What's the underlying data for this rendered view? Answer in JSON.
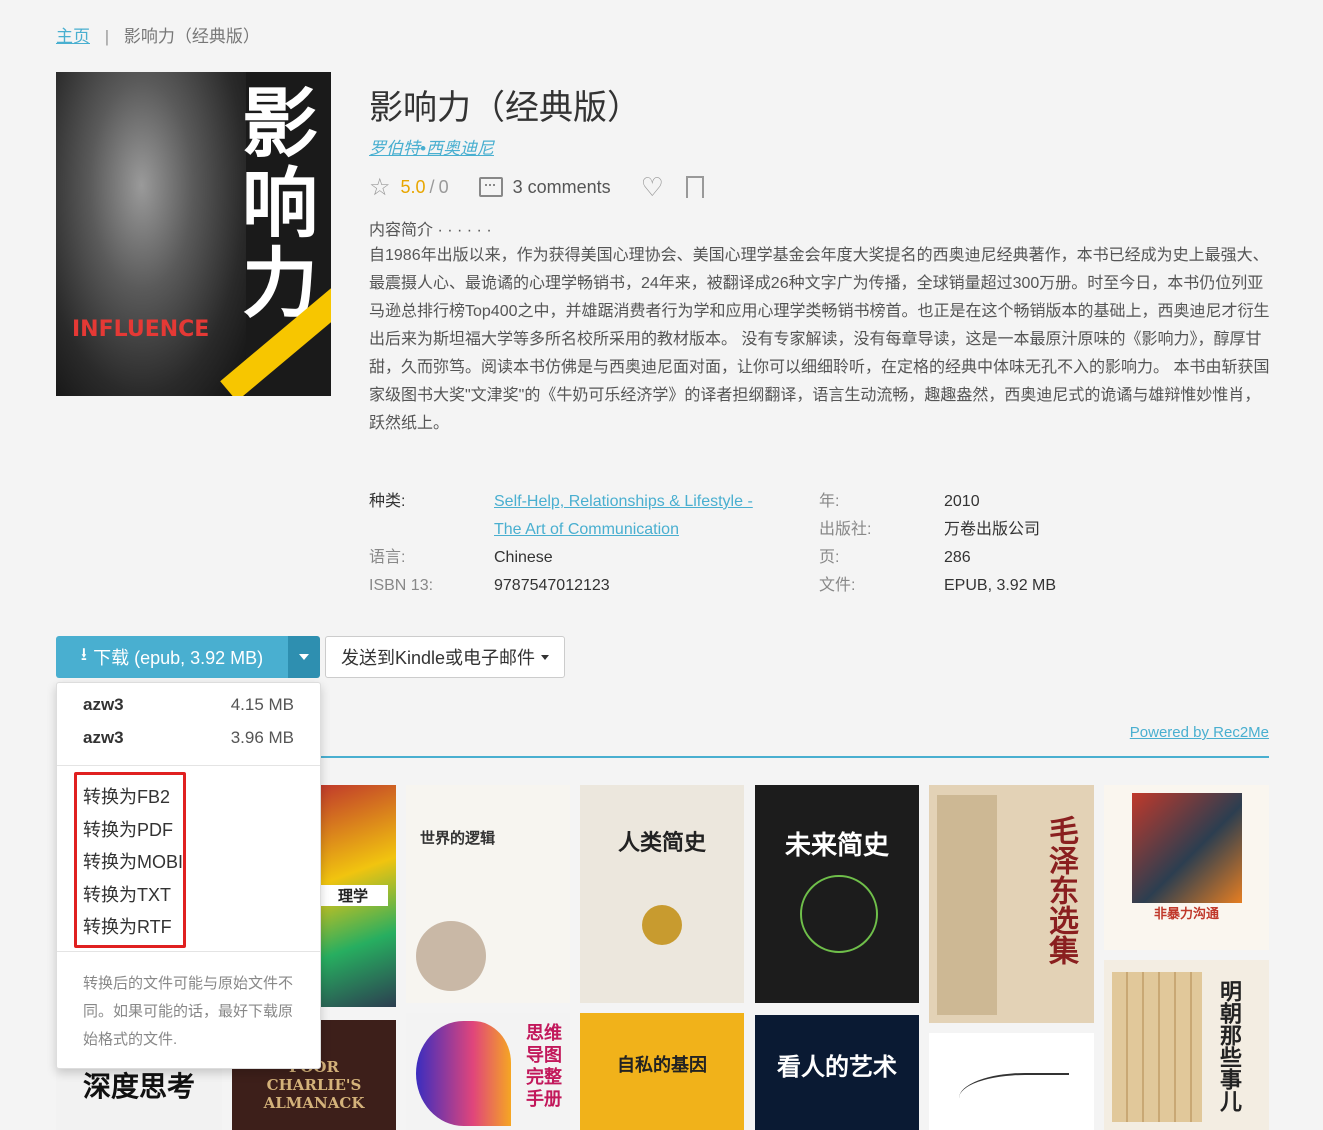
{
  "breadcrumb": {
    "home": "主页",
    "separator": "|",
    "current": "影响力（经典版）"
  },
  "book": {
    "title": "影响力（经典版）",
    "author": "罗伯特•西奥迪尼",
    "rating": "5.0",
    "rating_sep": "/",
    "rating_count": "0",
    "comments": "3 comments",
    "description_label": "内容简介 · · · · · ·",
    "description": "自1986年出版以来，作为获得美国心理协会、美国心理学基金会年度大奖提名的西奥迪尼经典著作，本书已经成为史上最强大、最震摄人心、最诡谲的心理学畅销书，24年来，被翻译成26种文字广为传播，全球销量超过300万册。时至今日，本书仍位列亚马逊总排行榜Top400之中，并雄踞消费者行为学和应用心理学类畅销书榜首。也正是在这个畅销版本的基础上，西奥迪尼才衍生出后来为斯坦福大学等多所名校所采用的教材版本。 没有专家解读，没有每章导读，这是一本最原汁原味的《影响力》，醇厚甘甜，久而弥笃。阅读本书仿佛是与西奥迪尼面对面，让你可以细细聆听，在定格的经典中体味无孔不入的影响力。 本书由斩获国家级图书大奖\"文津奖\"的《牛奶可乐经济学》的译者担纲翻译，语言生动流畅，趣趣盎然，西奥迪尼式的诡谲与雄辩惟妙惟肖，跃然纸上。",
    "cover": {
      "big_text": "影响力",
      "influence": "INFLUENCE"
    }
  },
  "properties": {
    "category_label": "种类:",
    "category_line1": "Self-Help, Relationships & Lifestyle -",
    "category_line2": "The Art of Communication",
    "language_label": "语言:",
    "language": "Chinese",
    "isbn_label": "ISBN 13:",
    "isbn": "9787547012123",
    "year_label": "年:",
    "year": "2010",
    "publisher_label": "出版社:",
    "publisher": "万卷出版公司",
    "pages_label": "页:",
    "pages": "286",
    "file_label": "文件:",
    "file": "EPUB, 3.92 MB"
  },
  "actions": {
    "download_label": "下载 (epub, 3.92 MB)",
    "send_label": "发送到Kindle或电子邮件"
  },
  "dropdown": {
    "files": [
      {
        "format": "azw3",
        "size": "4.15 MB"
      },
      {
        "format": "azw3",
        "size": "3.96 MB"
      }
    ],
    "conversions": [
      "转换为FB2",
      "转换为PDF",
      "转换为MOBI",
      "转换为TXT",
      "转换为RTF"
    ],
    "note": "转换后的文件可能与原始文件不同。如果可能的话，最好下载原始格式的文件."
  },
  "recommendations": {
    "powered_by": "Powered by Rec2Me",
    "books": [
      {
        "title": "世界的逻辑"
      },
      {
        "title": "人类简史"
      },
      {
        "title": "未来简史"
      },
      {
        "title": "毛泽东选集"
      },
      {
        "title": "非暴力沟通"
      },
      {
        "title": "深度思考"
      },
      {
        "title": "POOR CHARLIE'S ALMANACK"
      },
      {
        "title": "思维导图完整手册"
      },
      {
        "title": "自私的基因"
      },
      {
        "title": "看人的艺术"
      },
      {
        "title": "明朝那些事儿"
      },
      {
        "title": "理学"
      }
    ]
  }
}
